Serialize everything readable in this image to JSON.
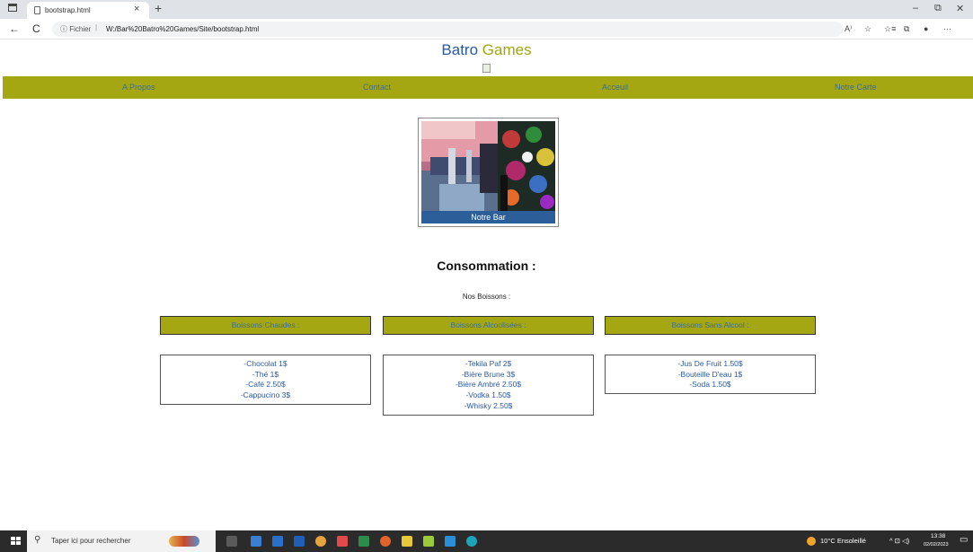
{
  "browser": {
    "tab_title": "bootstrap.html",
    "tab_close": "×",
    "new_tab": "+",
    "back": "←",
    "reload": "C",
    "address_info": "ⓘ Fichier",
    "address_sep": "|",
    "url": "W:/Bar%20Batro%20Games/Site/bootstrap.html",
    "minimize": "–",
    "restore": "⧉",
    "close": "✕",
    "toolbar_icons": [
      "A⁾",
      "☆",
      "☆≡",
      "⧉",
      "●",
      "···"
    ]
  },
  "site": {
    "brand_first": "Batro",
    "brand_second": "Games",
    "nav": [
      "A Propos",
      "Contact",
      "Acceuil",
      "Notre Carte"
    ]
  },
  "card": {
    "caption": "Notre Bar"
  },
  "section": {
    "title": "Consommation :",
    "subtitle": "Nos Boissons :"
  },
  "categories": [
    {
      "label": "Boissons Chaudes :",
      "items": [
        "-Chocolat 1$",
        "-Thé 1$",
        "-Café 2.50$",
        "-Cappucino 3$"
      ]
    },
    {
      "label": "Boissons Alcoolisées :",
      "items": [
        "-Tekila Paf 2$",
        "-Bière Brune 3$",
        "-Bière Ambré 2.50$",
        "-Vodka 1.50$",
        "-Whisky 2.50$"
      ]
    },
    {
      "label": "Boissons Sans Alcool :",
      "items": [
        "-Jus De Fruit 1.50$",
        "-Bouteille D'eau 1$",
        "-Soda 1.50$"
      ]
    }
  ],
  "taskbar": {
    "search_placeholder": "Taper ici pour rechercher",
    "weather": "10°C  Ensoleillé",
    "tray": "^  ⊡  ◁)",
    "time": "13:38",
    "date": "02/02/2023"
  }
}
